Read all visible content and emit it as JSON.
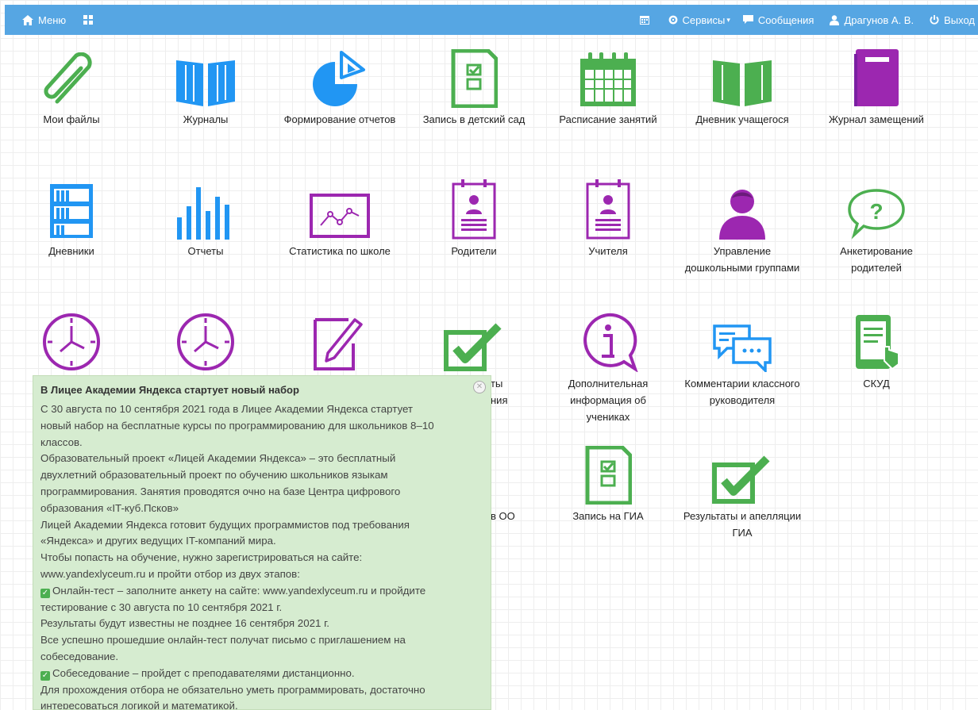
{
  "topbar": {
    "menu_label": "Меню",
    "services_label": "Сервисы",
    "messages_label": "Сообщения",
    "user_label": "Драгунов А. В.",
    "logout_label": "Выход"
  },
  "tiles": {
    "my_files": "Мои файлы",
    "journals": "Журналы",
    "reports_gen": "Формирование отчетов",
    "kindergarten": "Запись в детский сад",
    "schedule": "Расписание занятий",
    "student_diary": "Дневник учащегося",
    "substitutions": "Журнал замещений",
    "diaries": "Дневники",
    "reports": "Отчеты",
    "school_stats": "Статистика по школе",
    "parents": "Родители",
    "teachers": "Учителя",
    "preschool": "Управление дошкольными группами",
    "parent_survey": "Анкетирование родителей",
    "partial_results": "ты",
    "partial_results2": "ния",
    "extra_info": "Дополнительная информация об учениках",
    "teacher_comments": "Комментарии классного руководителя",
    "skud": "СКУД",
    "partial_oo": "в ОО",
    "gia_signup": "Запись на ГИА",
    "gia_results": "Результаты и апелляции ГИА"
  },
  "colors": {
    "topbar": "#56a6e3",
    "green": "#4caf50",
    "blue": "#2196f3",
    "purple": "#9c27b0"
  },
  "popup": {
    "title": "В Лицее Академии Яндекса стартует новый набор",
    "lines": [
      "С 30 августа по 10 сентября 2021 года в Лицее Академии Яндекса стартует",
      "новый набор на бесплатные курсы по программированию для школьников 8–10",
      "классов.",
      "Образовательный проект «Лицей Академии Яндекса» – это бесплатный",
      "двухлетний образовательный проект по обучению школьников языкам",
      "программирования.  Занятия проводятся очно на базе Центра цифрового",
      "образования «IT-куб.Псков»",
      "Лицей Академии Яндекса готовит будущих программистов под требования",
      "«Яндекса» и других ведущих IT-компаний мира.",
      "Чтобы попасть на обучение, нужно зарегистрироваться на сайте:",
      "www.yandexlyceum.ru и пройти отбор из двух этапов:",
      "Онлайн-тест – заполните анкету на сайте: www.yandexlyceum.ru и пройдите",
      "тестирование с 30 августа по 10 сентября 2021 г.",
      "Результаты будут известны не позднее 16 сентября 2021 г.",
      "Все успешно прошедшие онлайн-тест получат письмо с приглашением на",
      "собеседование.",
      "Собеседование – пройдет с преподавателями дистанционно.",
      "Для прохождения отбора не обязательно уметь программировать, достаточно",
      "интересоваться логикой и математикой."
    ]
  }
}
